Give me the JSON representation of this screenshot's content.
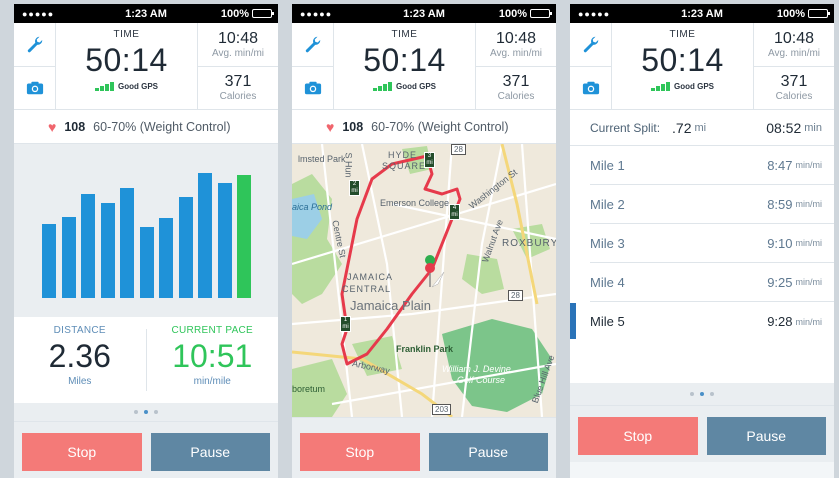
{
  "status": {
    "signal": "●●●●●",
    "time": "1:23 AM",
    "battery": "100%"
  },
  "header": {
    "time_label": "TIME",
    "time_value": "50:14",
    "gps": "Good GPS",
    "pace_value": "10:48",
    "pace_label": "Avg. min/mi",
    "calories_value": "371",
    "calories_label": "Calories"
  },
  "heart": {
    "bpm": "108",
    "zone": "60-70% (Weight Control)"
  },
  "bar_chart": {
    "values": [
      0.59,
      0.65,
      0.83,
      0.76,
      0.88,
      0.57,
      0.64,
      0.81,
      1.0,
      0.92,
      0.98
    ],
    "highlight_index": 10,
    "color": "#1f92d8",
    "highlight_color": "#2fc55a"
  },
  "metrics": {
    "distance_label": "DISTANCE",
    "distance_value": "2.36",
    "distance_unit": "Miles",
    "pace_label": "CURRENT PACE",
    "pace_value": "10:51",
    "pace_unit": "min/mile"
  },
  "buttons": {
    "stop": "Stop",
    "pause": "Pause"
  },
  "map": {
    "labels": {
      "imsted": "lmsted Park",
      "hyde": "HYDE",
      "square": "SQUARE",
      "road28a": "28",
      "emerson": "Emerson College",
      "washington": "Washington St",
      "centre": "Centre St",
      "pond": "aica Pond",
      "walnut": "Walnut Ave",
      "roxbury": "ROXBURY",
      "jamaica": "JAMAICA",
      "central": "CENTRAL",
      "plain": "Jamaica Plain",
      "road28b": "28",
      "franklin": "Franklin Park",
      "arborway": "Arborway",
      "golf1": "William J. Devine",
      "golf2": "Golf Course",
      "arboretum": "boretum",
      "blue": "Blue Hill Ave",
      "road203": "203",
      "shun": "S Hun"
    },
    "markers": {
      "m1": "1 mi",
      "m2": "2 mi",
      "m3": "3 mi",
      "m4": "4 mi"
    }
  },
  "splits": {
    "label": "Current Split:",
    "distance": ".72",
    "distance_unit": "mi",
    "time": "08:52",
    "time_unit": "min",
    "miles": [
      {
        "name": "Mile 1",
        "time": "8:47",
        "unit": "min/mi"
      },
      {
        "name": "Mile 2",
        "time": "8:59",
        "unit": "min/mi"
      },
      {
        "name": "Mile 3",
        "time": "9:10",
        "unit": "min/mi"
      },
      {
        "name": "Mile 4",
        "time": "9:25",
        "unit": "min/mi"
      },
      {
        "name": "Mile 5",
        "time": "9:28",
        "unit": "min/mi"
      }
    ]
  },
  "colors": {
    "stop": "#f47a78",
    "pause": "#5f87a3",
    "green": "#2fc55a",
    "blue": "#1f92d8"
  }
}
